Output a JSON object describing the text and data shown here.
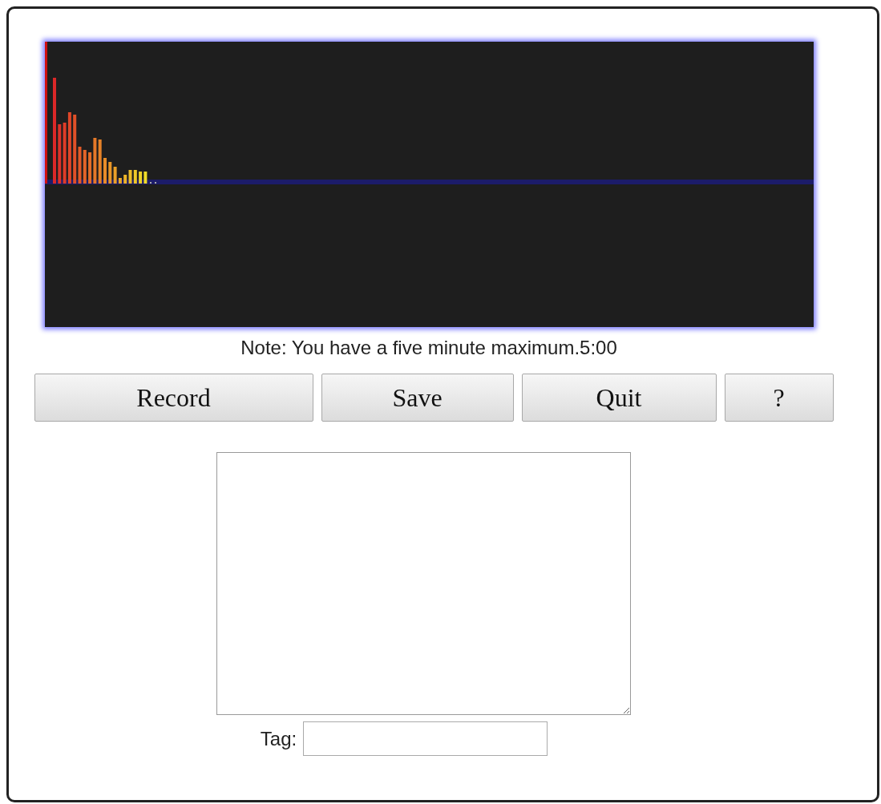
{
  "note": "Note: You have a five minute maximum.5:00",
  "buttons": [
    {
      "label": "Record"
    },
    {
      "label": "Save"
    },
    {
      "label": "Quit"
    },
    {
      "label": "?"
    }
  ],
  "tag": {
    "label": "Tag:"
  }
}
